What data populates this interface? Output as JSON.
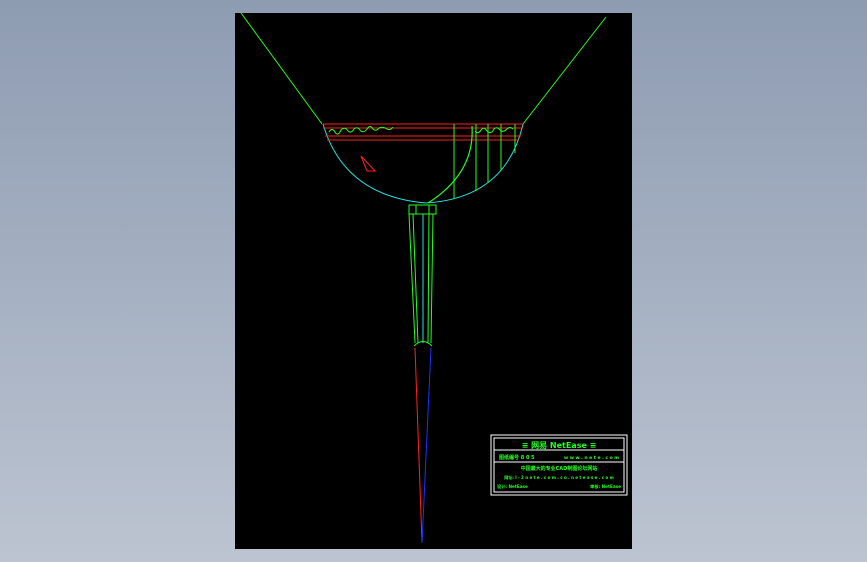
{
  "viewport": {
    "background_colors": [
      "#8e9cb2",
      "#bcc4d1"
    ]
  },
  "sheet": {
    "background": "#000000"
  },
  "colors": {
    "green": "#22ff22",
    "cyan": "#22e0e0",
    "red": "#ff2020",
    "blue": "#2030ff",
    "white": "#ffffff"
  },
  "title_block": {
    "header": "≡ 网易 NetEase ≡",
    "line1_left": "图纸编号 8 0 5",
    "line1_right": "w w w . n e t e . c o m",
    "line2": "中国最大的专业CAD制图论坛网站",
    "line3": "网址: l - 2 n e t e . c o m . c o . n e t e a s e . c o m",
    "line4_left": "设计: NetEase",
    "line4_right": "审核: NetEase"
  }
}
